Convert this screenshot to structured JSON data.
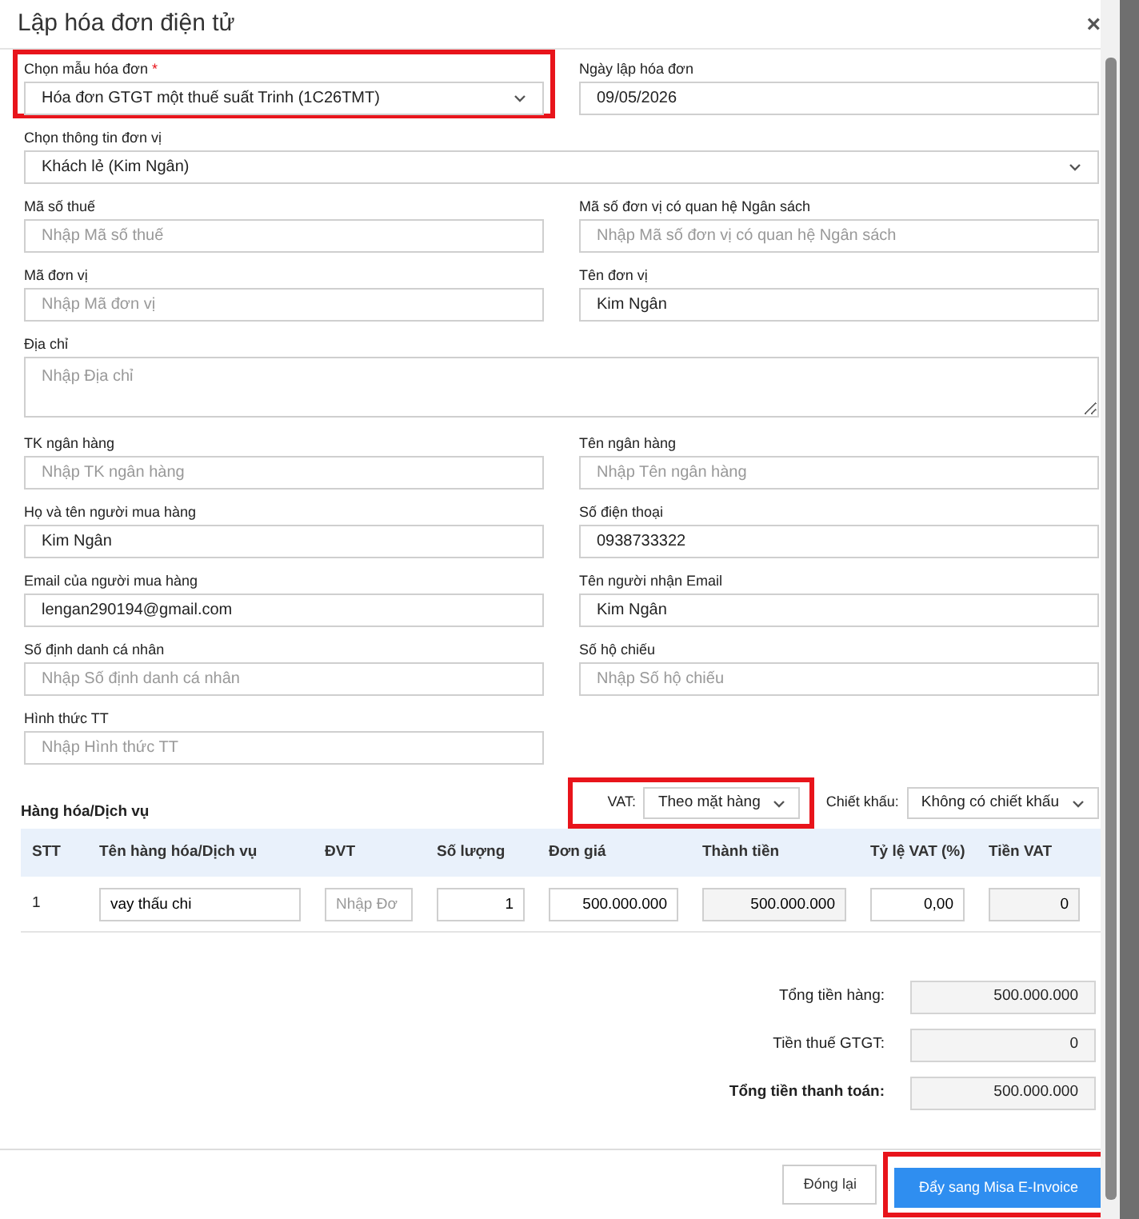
{
  "modal": {
    "title": "Lập hóa đơn điện tử",
    "close": "×"
  },
  "fields": [
    {
      "label": "Chọn mẫu hóa đơn",
      "required_mark": "*",
      "kind": "select",
      "value": "Hóa đơn GTGT một thuế suất Trinh (1C26TMT)",
      "wide": false,
      "highlighted": true
    },
    {
      "label": "Ngày lập hóa đơn",
      "kind": "input",
      "value": "09/05/2026",
      "wide": false,
      "highlighted": false
    },
    {
      "label": "Chọn thông tin đơn vị",
      "kind": "select",
      "value": "Khách lẻ (Kim Ngân)",
      "wide": true,
      "highlighted": false
    },
    {
      "label": "Mã số thuế",
      "kind": "input",
      "placeholder": "Nhập Mã số thuế",
      "wide": false,
      "highlighted": false
    },
    {
      "label": "Mã số đơn vị có quan hệ Ngân sách",
      "kind": "input",
      "placeholder": "Nhập Mã số đơn vị có quan hệ Ngân sách",
      "wide": false,
      "highlighted": false
    },
    {
      "label": "Mã đơn vị",
      "kind": "input",
      "placeholder": "Nhập Mã đơn vị",
      "wide": false,
      "highlighted": false
    },
    {
      "label": "Tên đơn vị",
      "kind": "input",
      "value": "Kim Ngân",
      "wide": false,
      "highlighted": false
    },
    {
      "label": "Địa chỉ",
      "kind": "textarea",
      "placeholder": "Nhập Địa chỉ",
      "wide": true,
      "highlighted": false
    },
    {
      "label": "TK ngân hàng",
      "kind": "input",
      "placeholder": "Nhập TK ngân hàng",
      "wide": false,
      "highlighted": false
    },
    {
      "label": "Tên ngân hàng",
      "kind": "input",
      "placeholder": "Nhập Tên ngân hàng",
      "wide": false,
      "highlighted": false
    },
    {
      "label": "Họ và tên người mua hàng",
      "kind": "input",
      "value": "Kim Ngân",
      "wide": false,
      "highlighted": false
    },
    {
      "label": "Số điện thoại",
      "kind": "input",
      "value": "0938733322",
      "wide": false,
      "highlighted": false
    },
    {
      "label": "Email của người mua hàng",
      "kind": "input",
      "value": "lengan290194@gmail.com",
      "wide": false,
      "highlighted": false
    },
    {
      "label": "Tên người nhận Email",
      "kind": "input",
      "value": "Kim Ngân",
      "wide": false,
      "highlighted": false
    },
    {
      "label": "Số định danh cá nhân",
      "kind": "input",
      "placeholder": "Nhập Số định danh cá nhân",
      "wide": false,
      "highlighted": false
    },
    {
      "label": "Số hộ chiếu",
      "kind": "input",
      "placeholder": "Nhập Số hộ chiếu",
      "wide": false,
      "highlighted": false
    },
    {
      "label": "Hình thức TT",
      "kind": "input",
      "placeholder": "Nhập Hình thức TT",
      "wide": false,
      "highlighted": false
    }
  ],
  "goods": {
    "title": "Hàng hóa/Dịch vụ",
    "vat": {
      "label": "VAT:",
      "value": "Theo mặt hàng",
      "highlighted": true
    },
    "discount": {
      "label": "Chiết khấu:",
      "value": "Không có chiết khấu",
      "highlighted": false
    },
    "columns": [
      "STT",
      "Tên hàng hóa/Dịch vụ",
      "ĐVT",
      "Số lượng",
      "Đơn giá",
      "Thành tiền",
      "Tỷ lệ VAT (%)",
      "Tiền VAT"
    ],
    "rows": [
      {
        "cells": [
          {
            "kind": "text",
            "value": "1"
          },
          {
            "kind": "input",
            "value": "vay thấu chi"
          },
          {
            "kind": "input",
            "placeholder": "Nhập Đơ"
          },
          {
            "kind": "number",
            "value": "1"
          },
          {
            "kind": "number",
            "value": "500.000.000"
          },
          {
            "kind": "readonly",
            "value": "500.000.000"
          },
          {
            "kind": "number",
            "value": "0,00"
          },
          {
            "kind": "readonly",
            "value": "0"
          }
        ]
      }
    ]
  },
  "totals": [
    {
      "label": "Tổng tiền hàng:",
      "value": "500.000.000",
      "bold": false
    },
    {
      "label": "Tiền thuế GTGT:",
      "value": "0",
      "bold": false
    },
    {
      "label": "Tổng tiền thanh toán:",
      "value": "500.000.000",
      "bold": true
    }
  ],
  "buttons": [
    {
      "label": "Đóng lại",
      "kind": "secondary",
      "highlighted": false
    },
    {
      "label": "Đẩy sang Misa E-Invoice",
      "kind": "primary",
      "highlighted": true
    }
  ]
}
